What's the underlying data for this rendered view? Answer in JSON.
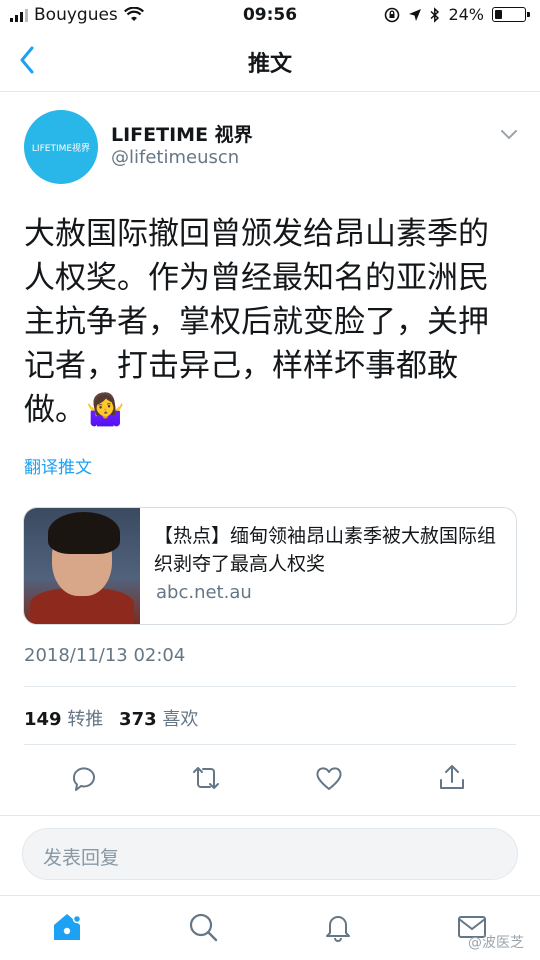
{
  "status_bar": {
    "carrier": "Bouygues",
    "time": "09:56",
    "battery_text": "24%",
    "battery_level": 0.24,
    "icons": [
      "signal-icon",
      "wifi-icon",
      "lock-rotation-icon",
      "location-icon",
      "bluetooth-icon",
      "battery-icon"
    ]
  },
  "nav": {
    "back_icon": "chevron-left-icon",
    "title": "推文"
  },
  "tweet": {
    "avatar_text": "LIFETIME视界",
    "display_name": "LIFETIME 视界",
    "handle": "@lifetimeuscn",
    "text": "大赦国际撤回曾颁发给昂山素季的人权奖。作为曾经最知名的亚洲民主抗争者，掌权后就变脸了，关押记者，打击异己，样样坏事都敢做。🤷‍♀️",
    "translate_label": "翻译推文",
    "card": {
      "title": "【热点】缅甸领袖昂山素季被大赦国际组织剥夺了最高人权奖",
      "domain": "abc.net.au"
    },
    "timestamp": "2018/11/13 02:04",
    "retweets_count": "149",
    "retweets_label": "转推",
    "likes_count": "373",
    "likes_label": "喜欢"
  },
  "actions": [
    "reply-icon",
    "retweet-icon",
    "like-icon",
    "share-icon"
  ],
  "reply_placeholder": "发表回复",
  "tabbar": [
    "home-icon",
    "search-icon",
    "notifications-icon",
    "messages-icon"
  ],
  "watermark": "@波医芝",
  "colors": {
    "accent": "#1da1f2",
    "secondary_text": "#657786",
    "avatar_bg": "#29b6e8"
  }
}
